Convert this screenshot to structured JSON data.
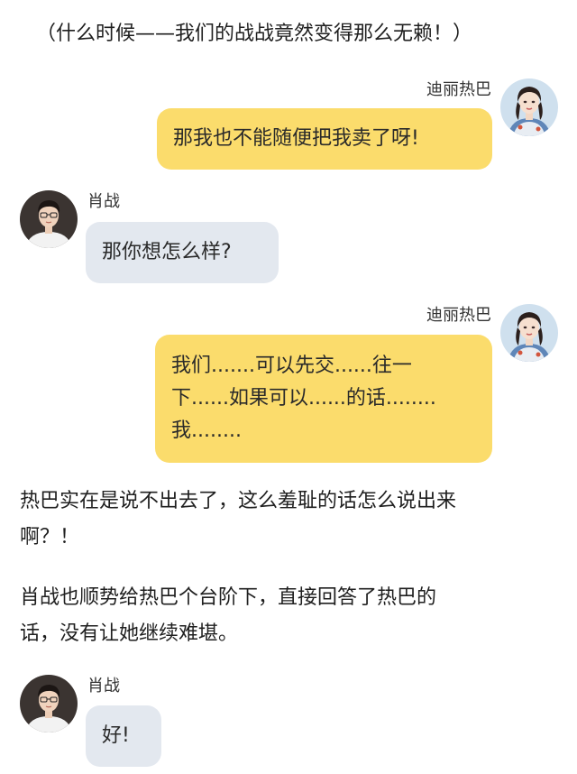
{
  "messages": [
    {
      "sender": "迪丽热巴",
      "text": "那我也不能随便把我卖了呀!"
    },
    {
      "sender": "肖战",
      "text": "那你想怎么样?"
    },
    {
      "sender": "迪丽热巴",
      "line1": "我们.......可以先交......往一",
      "line2": "下......如果可以......的话........",
      "line3": "我........"
    },
    {
      "sender": "肖战",
      "text": "好!"
    }
  ],
  "narration": {
    "top": "（什么时候——我们的战战竟然变得那么无赖！）",
    "para1_line1": "热巴实在是说不出去了，这么羞耻的话怎么说出来",
    "para1_line2": "啊？！",
    "para2_line1": "肖战也顺势给热巴个台阶下，直接回答了热巴的",
    "para2_line2": "话，没有让她继续难堪。"
  },
  "colors": {
    "self_bubble": "#fbdc6c",
    "other_bubble": "#e3e8ef"
  },
  "icons": {
    "dilireba_avatar": "female-portrait-avatar",
    "xiaozhan_avatar": "male-portrait-avatar"
  }
}
